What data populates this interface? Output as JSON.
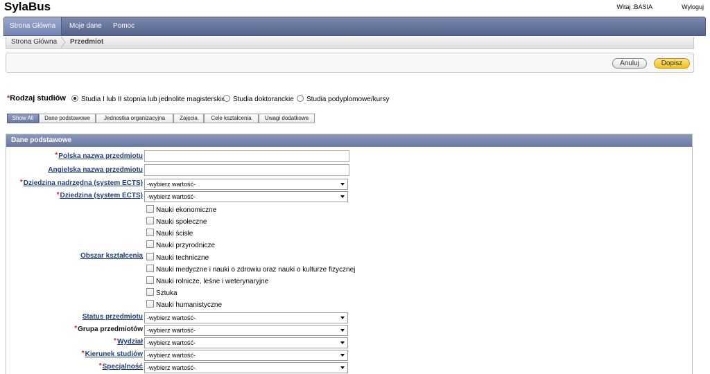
{
  "app": {
    "title": "SylaBus",
    "welcome": "Witaj :BASIA",
    "logout": "Wyloguj"
  },
  "nav": {
    "items": [
      "Strona Główna",
      "Moje dane",
      "Pomoc"
    ],
    "active": "Strona Główna"
  },
  "breadcrumb": {
    "home": "Strona Główna",
    "current": "Przedmiot"
  },
  "actions": {
    "cancel": "Anuluj",
    "save": "Dopisz"
  },
  "study_type": {
    "label": "Rodzaj studiów",
    "options": [
      "Studia I lub II stopnia lub jednolite magisterskie",
      "Studia doktoranckie",
      "Studia podyplomowe/kursy"
    ],
    "selected": "Studia I lub II stopnia lub jednolite magisterskie"
  },
  "tabs": {
    "items": [
      "Show All",
      "Dane podstawowe",
      "Jednostka organizacyjna",
      "Zajęcia",
      "Cele kształcenia",
      "Uwagi dodatkowe"
    ],
    "active": "Show All"
  },
  "panel": {
    "title": "Dane podstawowe"
  },
  "fields": {
    "polish_name": {
      "label": "Polska nazwa przedmiotu",
      "value": ""
    },
    "english_name": {
      "label": "Angielska nazwa przedmiotu",
      "value": ""
    },
    "parent_domain": {
      "label": "Dziedzina nadrzędna (system ECTS)",
      "value": "-wybierz wartość-"
    },
    "domain": {
      "label": "Dziedzina (system ECTS)",
      "value": "-wybierz wartość-"
    },
    "education_area": {
      "label": "Obszar kształcenia",
      "options": [
        "Nauki ekonomiczne",
        "Nauki społeczne",
        "Nauki ścisłe",
        "Nauki przyrodnicze",
        "Nauki techniczne",
        "Nauki medyczne i nauki o zdrowiu oraz nauki o kulturze fizycznej",
        "Nauki rolnicze, leśne i weterynaryjne",
        "Sztuka",
        "Nauki humanistyczne"
      ]
    },
    "status": {
      "label": "Status przedmiotu",
      "value": "-wybierz wartość-"
    },
    "course_group": {
      "label": "Grupa przedmiotów",
      "value": "-wybierz wartość-"
    },
    "faculty": {
      "label": "Wydział",
      "value": "-wybierz wartość-"
    },
    "field_of_study": {
      "label": "Kierunek studiów",
      "value": "-wybierz wartość-"
    },
    "specialty": {
      "label": "Specjalność",
      "value": "-wybierz wartość-"
    }
  }
}
